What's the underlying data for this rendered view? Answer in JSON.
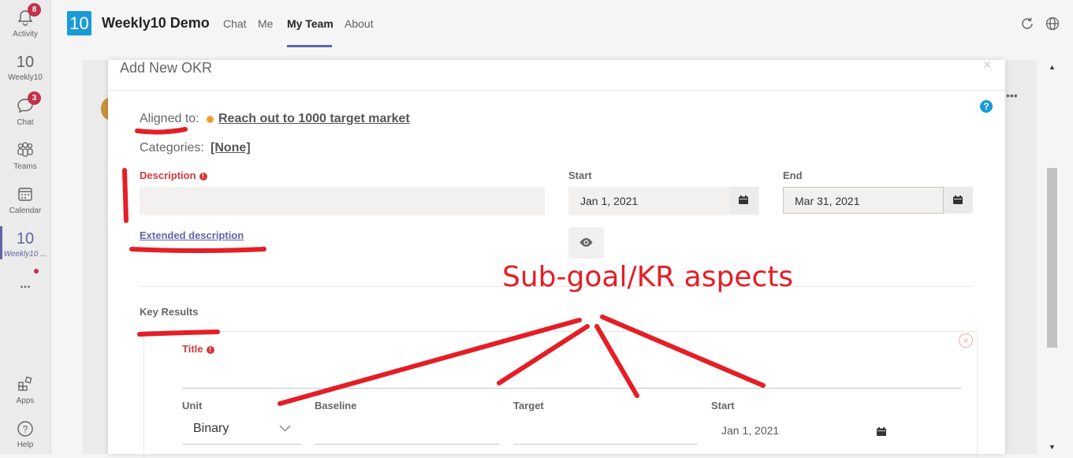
{
  "rail": {
    "items": [
      {
        "label": "Activity",
        "badge": "8"
      },
      {
        "label": "Weekly10"
      },
      {
        "label": "Chat",
        "badge": "3"
      },
      {
        "label": "Teams"
      },
      {
        "label": "Calendar"
      },
      {
        "label": "Weekly10 ..."
      },
      {
        "label": "Apps"
      },
      {
        "label": "Help"
      }
    ],
    "more": "..."
  },
  "header": {
    "logo": "10",
    "app_name": "Weekly10 Demo",
    "tabs": [
      "Chat",
      "Me",
      "My Team",
      "About"
    ],
    "active_tab": "My Team"
  },
  "modal": {
    "title": "Add New OKR",
    "close": "×",
    "help": "?",
    "aligned_label": "Aligned to:",
    "aligned_value": "Reach out to 1000 target market",
    "categories_label": "Categories:",
    "categories_value": "[None]",
    "description_label": "Description",
    "start_label": "Start",
    "start_value": "Jan 1, 2021",
    "end_label": "End",
    "end_value": "Mar 31, 2021",
    "extended_description": "Extended description",
    "key_results_label": "Key Results",
    "kr": {
      "title_label": "Title",
      "unit_label": "Unit",
      "unit_value": "Binary",
      "baseline_label": "Baseline",
      "target_label": "Target",
      "start_label": "Start",
      "start_value": "Jan 1, 2021"
    }
  },
  "annotation": {
    "text": "Sub-goal/KR aspects",
    "color": "#e51e25"
  },
  "colors": {
    "accent": "#6264a7",
    "badge": "#c4314b",
    "brand": "#1a9bd7",
    "required": "#d03a3a"
  }
}
